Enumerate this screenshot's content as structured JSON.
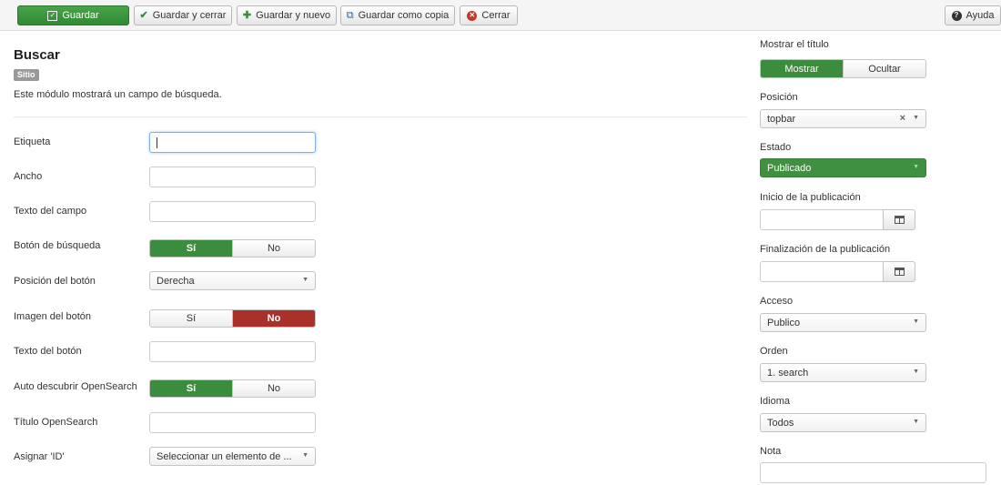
{
  "toolbar": {
    "save": "Guardar",
    "save_close": "Guardar y cerrar",
    "save_new": "Guardar y nuevo",
    "save_copy": "Guardar como copia",
    "close": "Cerrar",
    "help": "Ayuda"
  },
  "module": {
    "title": "Buscar",
    "badge": "Sitio",
    "description": "Este módulo mostrará un campo de búsqueda."
  },
  "fields": {
    "label": {
      "label": "Etiqueta",
      "value": ""
    },
    "width": {
      "label": "Ancho",
      "value": ""
    },
    "field_text": {
      "label": "Texto del campo",
      "value": ""
    },
    "search_button": {
      "label": "Botón de búsqueda",
      "yes": "Sí",
      "no": "No",
      "selected": "Sí"
    },
    "button_position": {
      "label": "Posición del botón",
      "selected": "Derecha"
    },
    "button_image": {
      "label": "Imagen del botón",
      "yes": "Sí",
      "no": "No",
      "selected": "No"
    },
    "button_text": {
      "label": "Texto del botón",
      "value": ""
    },
    "opensearch_auto": {
      "label": "Auto descubrir OpenSearch",
      "yes": "Sí",
      "no": "No",
      "selected": "Sí"
    },
    "opensearch_title": {
      "label": "Título OpenSearch",
      "value": ""
    },
    "assign_id": {
      "label": "Asignar 'ID'",
      "selected": "Seleccionar un elemento de ..."
    }
  },
  "sidebar": {
    "show_title": {
      "label": "Mostrar el título",
      "show": "Mostrar",
      "hide": "Ocultar",
      "selected": "Mostrar"
    },
    "position": {
      "label": "Posición",
      "selected": "topbar"
    },
    "status": {
      "label": "Estado",
      "selected": "Publicado"
    },
    "publish_up": {
      "label": "Inicio de la publicación",
      "value": ""
    },
    "publish_down": {
      "label": "Finalización de la publicación",
      "value": ""
    },
    "access": {
      "label": "Acceso",
      "selected": "Publico"
    },
    "ordering": {
      "label": "Orden",
      "selected": "1. search"
    },
    "language": {
      "label": "Idioma",
      "selected": "Todos"
    },
    "note": {
      "label": "Nota",
      "value": ""
    }
  },
  "colors": {
    "primary_green": "#3c8c3e",
    "danger_red": "#a8312b"
  }
}
